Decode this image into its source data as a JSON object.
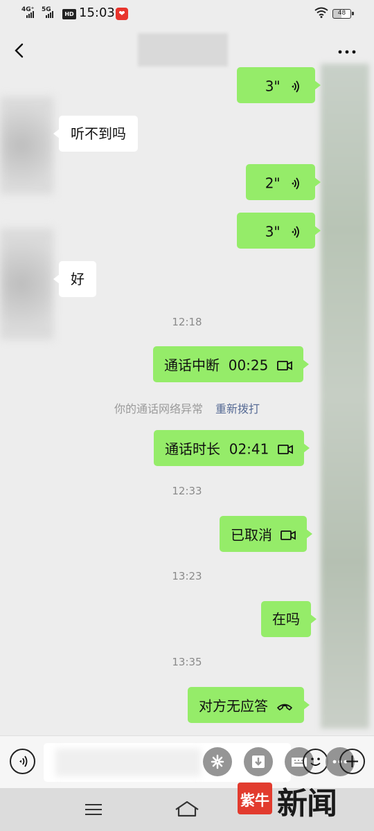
{
  "status_bar": {
    "network_1": "4G⁺",
    "network_2": "5G",
    "hd_badge": "HD",
    "time": "15:03",
    "battery": "48"
  },
  "messages": {
    "voice_1": "3\"",
    "incoming_1": "听不到吗",
    "voice_2": "2\"",
    "voice_3": "3\"",
    "incoming_2": "好",
    "time_1": "12:18",
    "call_interrupted": "通话中断  00:25",
    "network_notice": "你的通话网络异常",
    "redial_link": "重新拨打",
    "call_duration": "通话时长  02:41",
    "time_2": "12:33",
    "cancelled": "已取消",
    "time_3": "13:23",
    "text_out": "在吗",
    "time_4": "13:35",
    "no_answer": "对方无应答"
  },
  "watermark": {
    "logo_text": "紫牛",
    "text": "新闻"
  },
  "colors": {
    "outgoing_bubble": "#95ec69",
    "incoming_bubble": "#ffffff",
    "background": "#ededed",
    "link": "#576b95",
    "watermark_red": "#e23b2e"
  },
  "icons": {
    "voice_message": "voice-wave-icon",
    "video_call": "video-call-icon",
    "hangup": "phone-hangup-icon"
  }
}
